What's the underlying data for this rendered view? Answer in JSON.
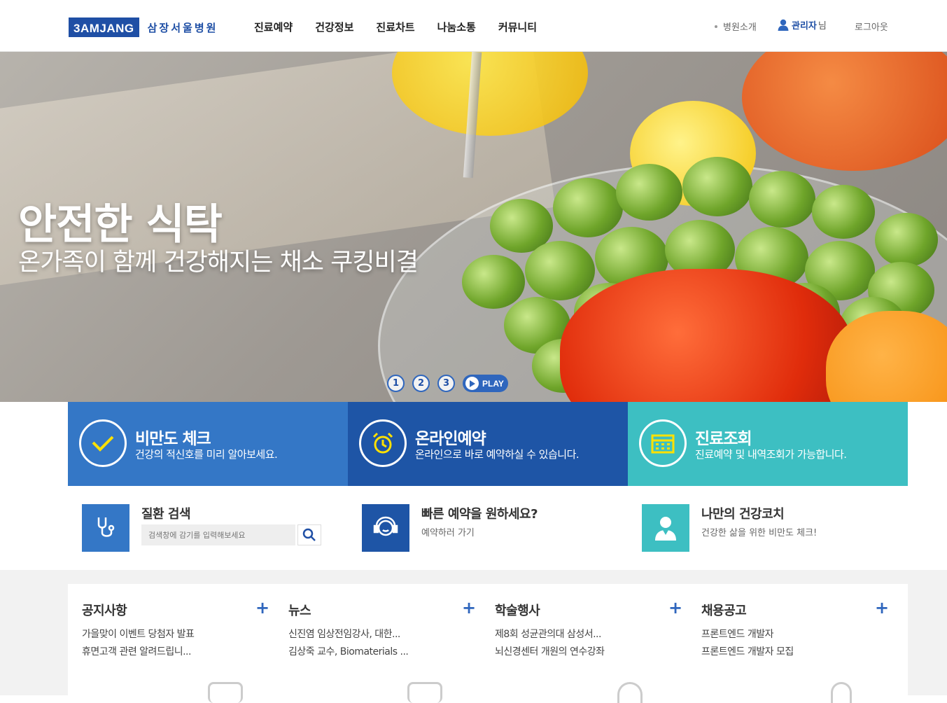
{
  "header": {
    "logo_mark": "3AMJANG",
    "logo_name": "삼장서울병원",
    "nav": [
      "진료예약",
      "건강정보",
      "진료차트",
      "나눔소통",
      "커뮤니티"
    ],
    "util": {
      "about": "병원소개",
      "user_name": "관리자",
      "user_suffix": "님",
      "logout": "로그아웃"
    }
  },
  "hero": {
    "title": "안전한 식탁",
    "subtitle": "온가족이 함께 건강해지는 채소 쿠킹비결",
    "pages": [
      "1",
      "2",
      "3"
    ],
    "play_label": "PLAY"
  },
  "quick": [
    {
      "title": "비만도 체크",
      "desc": "건강의 적신호를 미리 알아보세요.",
      "icon": "check-icon",
      "color": "#3477c6"
    },
    {
      "title": "온라인예약",
      "desc": "온라인으로 바로 예약하실 수 있습니다.",
      "icon": "alarm-clock-icon",
      "color": "#1e55a6"
    },
    {
      "title": "진료조회",
      "desc": "진료예약 및 내역조회가 가능합니다.",
      "icon": "calendar-icon",
      "color": "#3dbfc2"
    }
  ],
  "services": {
    "search": {
      "title": "질환 검색",
      "placeholder": "검색창에 감기를 입력해보세요",
      "icon": "stethoscope-icon"
    },
    "reserve": {
      "title": "빠른 예약을 원하세요?",
      "desc": "예약하러 가기",
      "icon": "headset-icon"
    },
    "coach": {
      "title": "나만의 건강코치",
      "desc": "건강한 삶을 위한 비만도 체크!",
      "icon": "doctor-icon"
    }
  },
  "boards": [
    {
      "title": "공지사항",
      "items": [
        "가을맞이 이벤트 당첨자 발표",
        "휴면고객 관련 알려드립니..."
      ]
    },
    {
      "title": "뉴스",
      "items": [
        "신진염 임상전임강사, 대한...",
        "김상죽 교수, Biomaterials ..."
      ]
    },
    {
      "title": "학술행사",
      "items": [
        "제8회 성균관의대 삼성서...",
        "뇌신경센터 개원의 연수강좌"
      ]
    },
    {
      "title": "채용공고",
      "items": [
        "프론트엔드 개발자",
        "프론트엔드 개발자 모집"
      ]
    }
  ],
  "colors": {
    "brand": "#1f4fa5",
    "accent": "#2f66bd",
    "teal": "#3dbfc2"
  }
}
